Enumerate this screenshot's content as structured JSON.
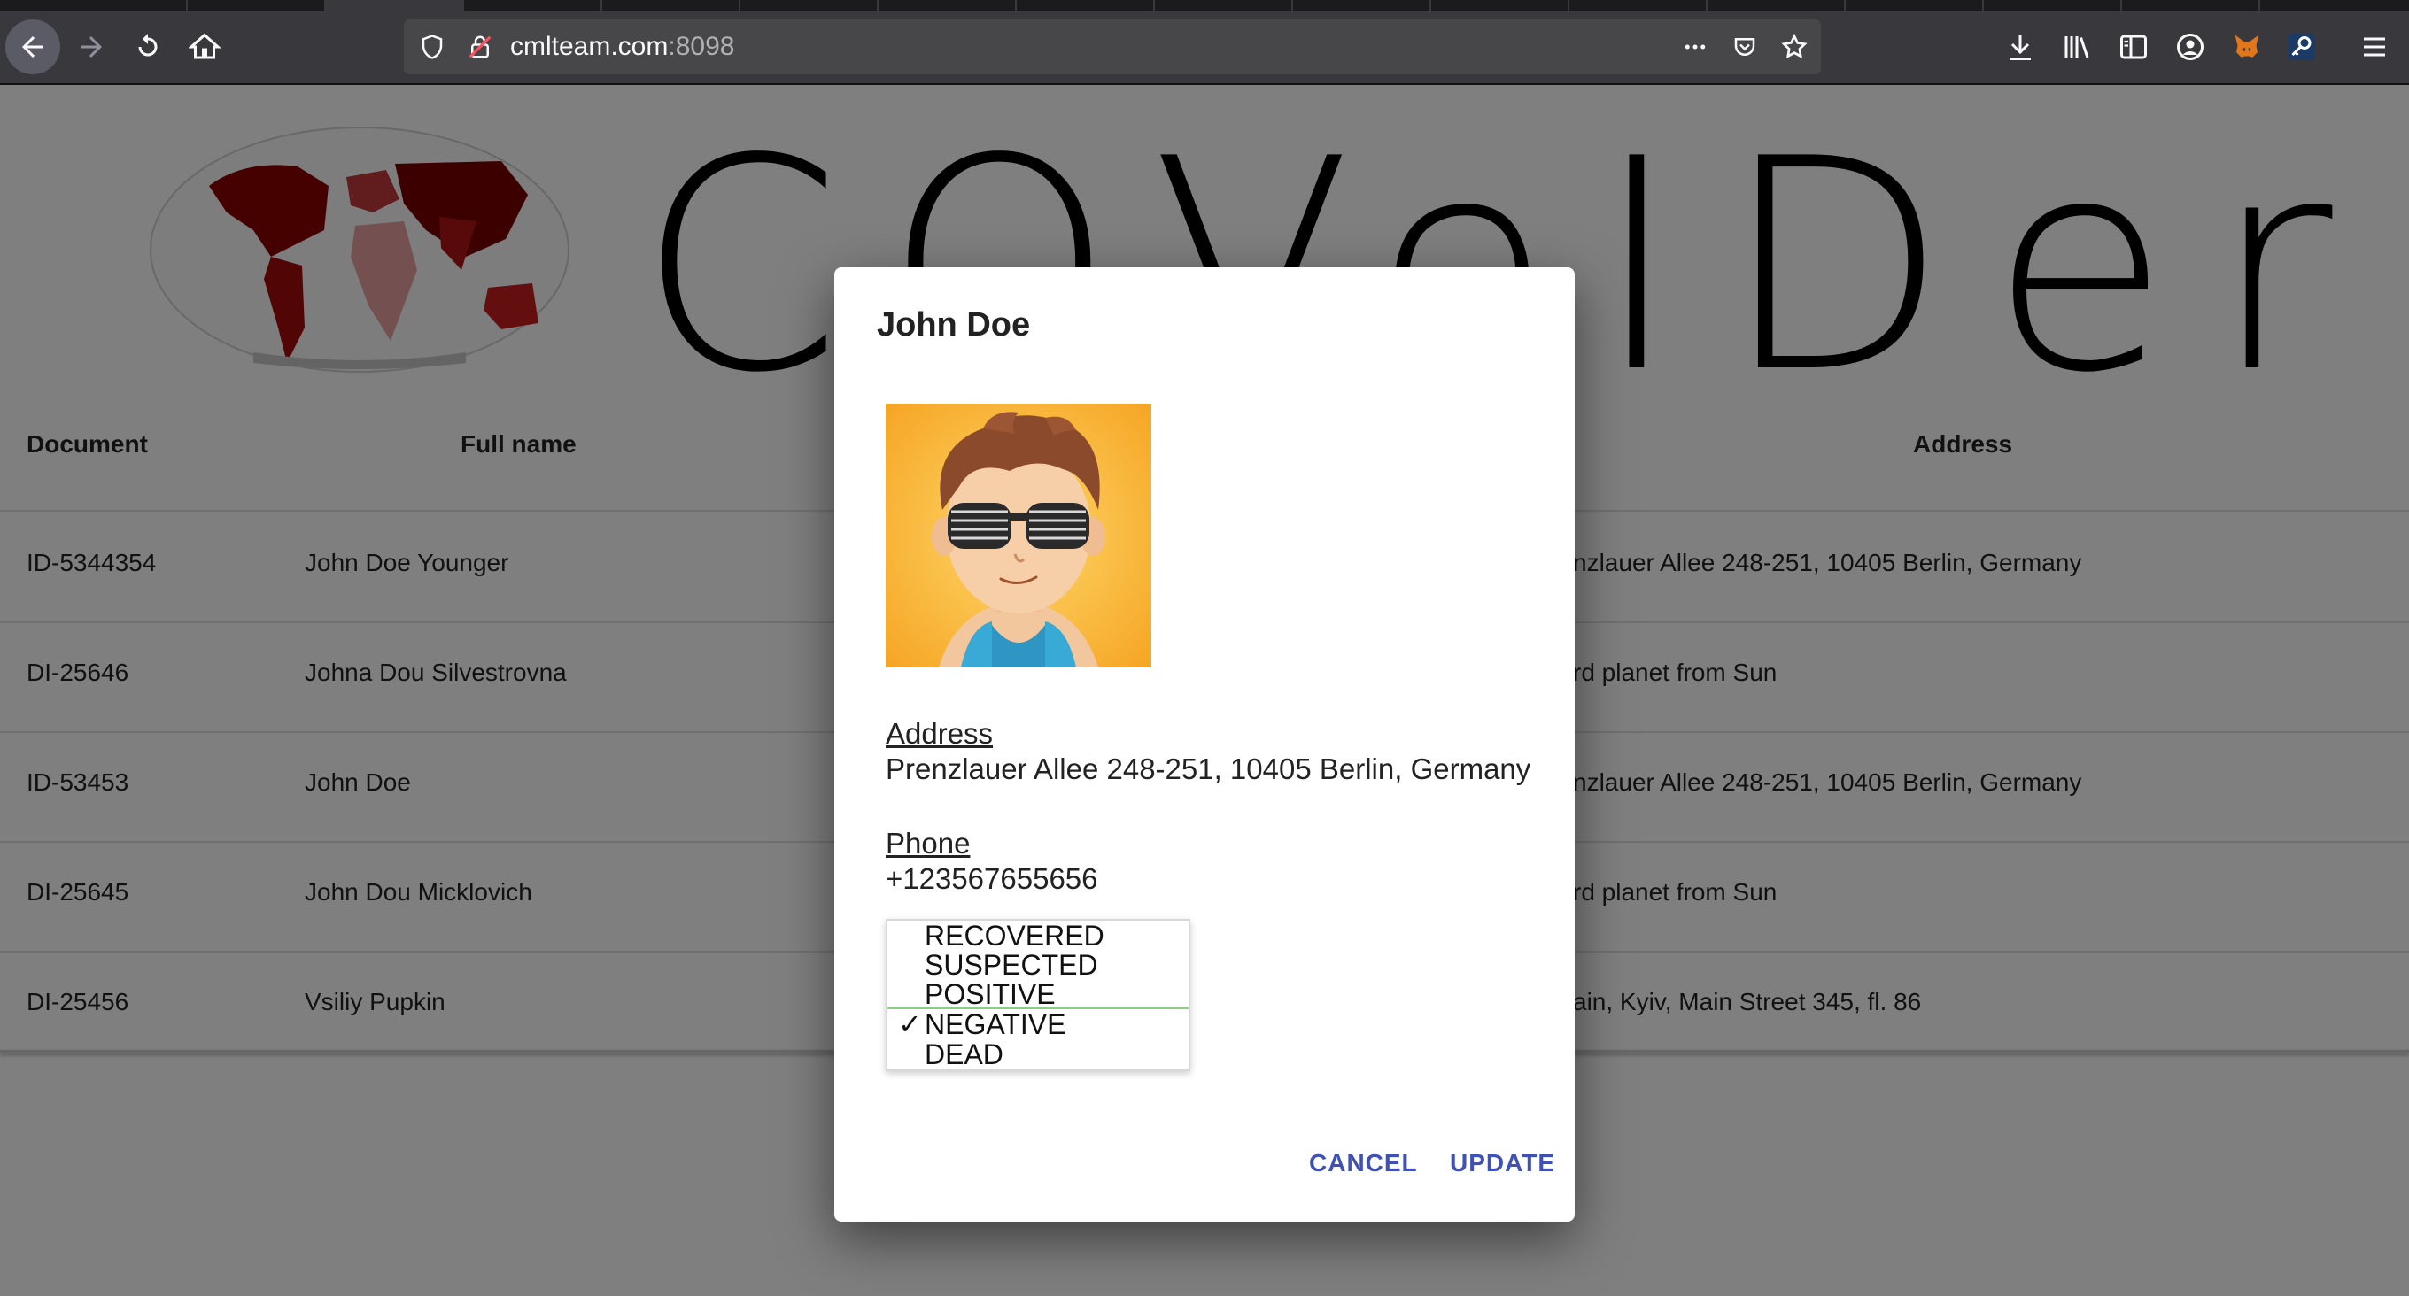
{
  "browser": {
    "url_host": "cmlteam.com",
    "url_port": ":8098"
  },
  "page": {
    "brand": "COVeIDer",
    "table": {
      "headers": {
        "document": "Document",
        "full_name": "Full name",
        "address": "Address"
      },
      "rows": [
        {
          "document": "ID-5344354",
          "full_name": "John Doe Younger",
          "address": "nzlauer Allee 248-251, 10405 Berlin, Germany"
        },
        {
          "document": "DI-25646",
          "full_name": "Johna Dou Silvestrovna",
          "address": "rd planet from Sun"
        },
        {
          "document": "ID-53453",
          "full_name": "John Doe",
          "address": "nzlauer Allee 248-251, 10405 Berlin, Germany"
        },
        {
          "document": "DI-25645",
          "full_name": "John Dou Micklovich",
          "address": "rd planet from Sun"
        },
        {
          "document": "DI-25456",
          "full_name": "Vsiliy Pupkin",
          "address": "ain, Kyiv, Main Street 345, fl. 86"
        }
      ]
    }
  },
  "dialog": {
    "title": "John Doe",
    "address_label": "Address",
    "address_value": "Prenzlauer Allee 248-251, 10405 Berlin, Germany",
    "phone_label": "Phone",
    "phone_value": "+123567655656",
    "status_options": [
      "RECOVERED",
      "SUSPECTED",
      "POSITIVE",
      "NEGATIVE",
      "DEAD"
    ],
    "status_selected": "NEGATIVE",
    "check_mark": "✓",
    "cancel_label": "CANCEL",
    "update_label": "UPDATE"
  },
  "colors": {
    "accent": "#3f51b5",
    "chrome": "#38383d",
    "urlbar": "#474749"
  }
}
